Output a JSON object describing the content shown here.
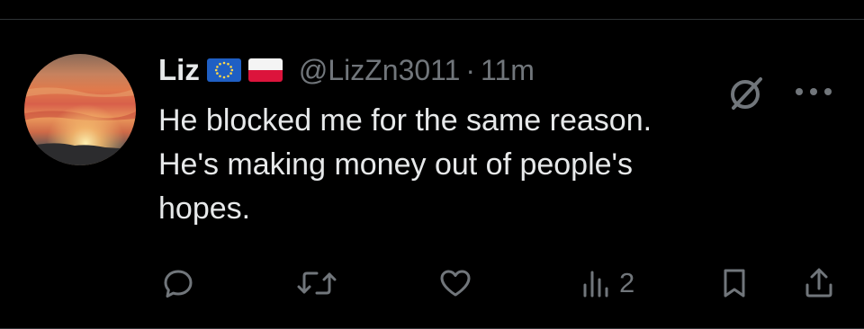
{
  "tweet": {
    "author": {
      "name": "Liz",
      "flags": [
        "eu-flag-icon",
        "poland-flag-icon"
      ],
      "handle": "@LizZn3011",
      "separator": "·",
      "time": "11m"
    },
    "text": "He blocked me for the same reason.\nHe's making money out of people's\nhopes.",
    "actions": {
      "views": "2"
    },
    "icons": {
      "grok": "grok-icon",
      "more": "more-icon",
      "reply": "reply-icon",
      "retweet": "retweet-icon",
      "like": "like-icon",
      "views": "views-icon",
      "bookmark": "bookmark-icon",
      "share": "share-icon"
    }
  },
  "colors": {
    "background": "#000000",
    "text_primary": "#e7e9ea",
    "text_secondary": "#71767b",
    "divider": "#2f3336"
  }
}
